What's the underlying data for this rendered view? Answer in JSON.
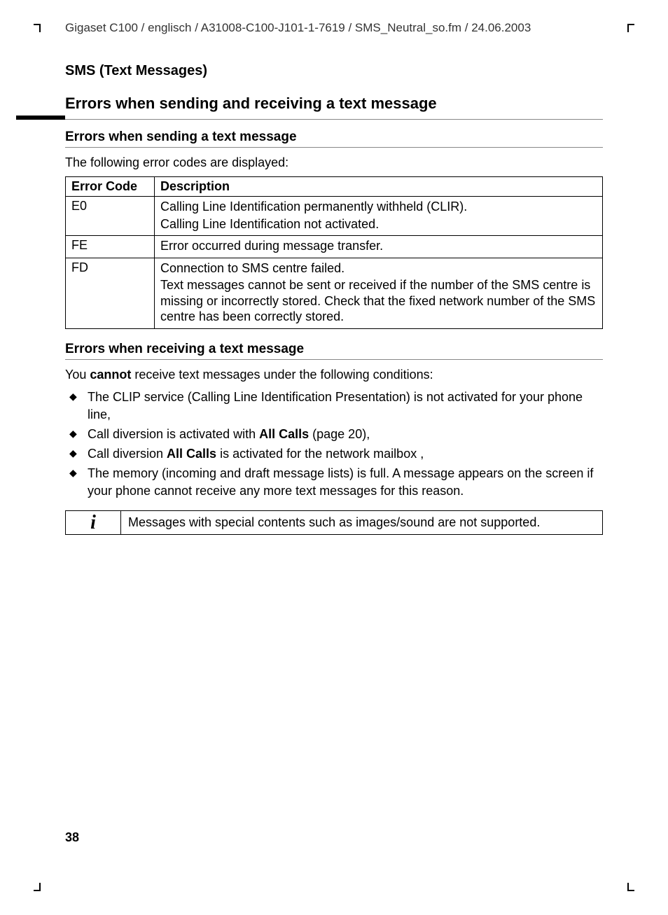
{
  "docpath": "Gigaset C100 / englisch / A31008-C100-J101-1-7619 / SMS_Neutral_so.fm / 24.06.2003",
  "section_header": "SMS (Text Messages)",
  "h1": "Errors when sending and receiving a text message",
  "sending": {
    "heading": "Errors when sending a text message",
    "intro": "The following error codes are displayed:",
    "table": {
      "col1": "Error Code",
      "col2": "Description",
      "rows": [
        {
          "code": "E0",
          "desc": [
            "Calling Line Identification permanently withheld (CLIR).",
            "Calling Line Identification not activated."
          ]
        },
        {
          "code": "FE",
          "desc": [
            "Error occurred during message transfer."
          ]
        },
        {
          "code": "FD",
          "desc": [
            "Connection to SMS centre failed.",
            "Text messages cannot be sent or received if the number of the SMS centre is missing or incorrectly stored. Check that the fixed network number of the SMS centre has been correctly stored."
          ]
        }
      ]
    }
  },
  "receiving": {
    "heading": "Errors when receiving a text message",
    "intro_pre": "You ",
    "intro_bold": "cannot",
    "intro_post": " receive text messages under the following conditions:",
    "bullets": [
      {
        "pre": "The CLIP service (Calling Line Identification Presentation) is not activated for your phone line,",
        "bold": "",
        "post": ""
      },
      {
        "pre": "Call diversion is activated with ",
        "bold": "All Calls",
        "post": " (page 20),"
      },
      {
        "pre": "Call diversion ",
        "bold": "All Calls",
        "post": " is activated for the network mailbox ,"
      },
      {
        "pre": "The memory (incoming and draft message lists) is full. A message appears on the screen if your phone cannot receive any more text messages for this reason.",
        "bold": "",
        "post": ""
      }
    ]
  },
  "info_icon": "i",
  "info_text": "Messages with special contents such as images/sound are not supported.",
  "page_number": "38"
}
